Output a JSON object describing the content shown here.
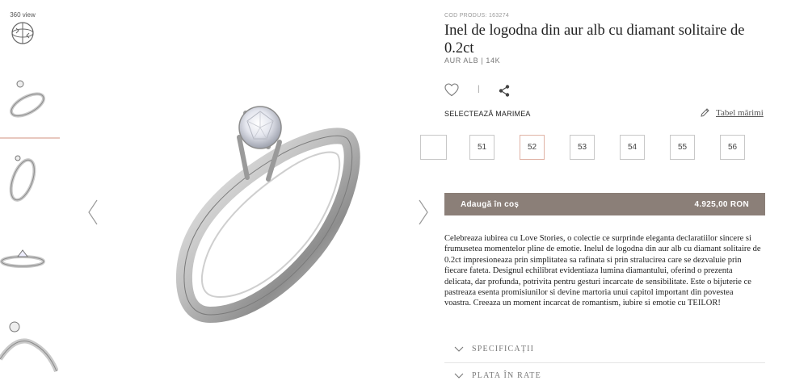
{
  "gallery": {
    "view360_label": "360 view",
    "thumbnails": [
      "ring-front",
      "ring-side",
      "ring-top",
      "ring-closeup"
    ]
  },
  "product": {
    "code": "COD PRODUS: 163274",
    "title": "Inel de logodna din aur alb cu diamant solitaire de 0.2ct",
    "subtitle": "AUR ALB | 14K",
    "separator": "|"
  },
  "size_selector": {
    "label": "SELECTEAZĂ MARIMEA",
    "size_table_link": "Tabel mărimi",
    "sizes": [
      "51",
      "52",
      "53",
      "54",
      "55",
      "56"
    ],
    "selected": "52"
  },
  "cart": {
    "add_label": "Adaugă în coș",
    "price": "4.925,00 RON"
  },
  "description": "Celebreaza iubirea cu Love Stories, o colectie ce surprinde eleganta declaratiilor sincere si frumusetea momentelor pline de emotie. Inelul de logodna din aur alb cu diamant solitaire de 0.2ct impresioneaza prin simplitatea sa rafinata si prin stralucirea care se dezvaluie prin fiecare fateta. Designul echilibrat evidentiaza lumina diamantului, oferind o prezenta delicata, dar profunda, potrivita pentru gesturi incarcate de sensibilitate. Este o bijuterie ce pastreaza esenta promisiunilor si devine martoria unui capitol important din povestea voastra. Creeaza un moment incarcat de romantism, iubire si emotie cu TEILOR!",
  "accordions": [
    {
      "title": "SPECIFICAȚII"
    },
    {
      "title": "PLATA ÎN RATE"
    }
  ],
  "colors": {
    "button_bg": "#8b7f78",
    "selected_size_border": "#e0b3a6",
    "active_thumb_line": "#e8c8bf"
  },
  "icons": [
    "360-view-icon",
    "heart-icon",
    "share-icon",
    "pencil-icon",
    "chevron-left-icon",
    "chevron-right-icon",
    "chevron-down-icon"
  ]
}
